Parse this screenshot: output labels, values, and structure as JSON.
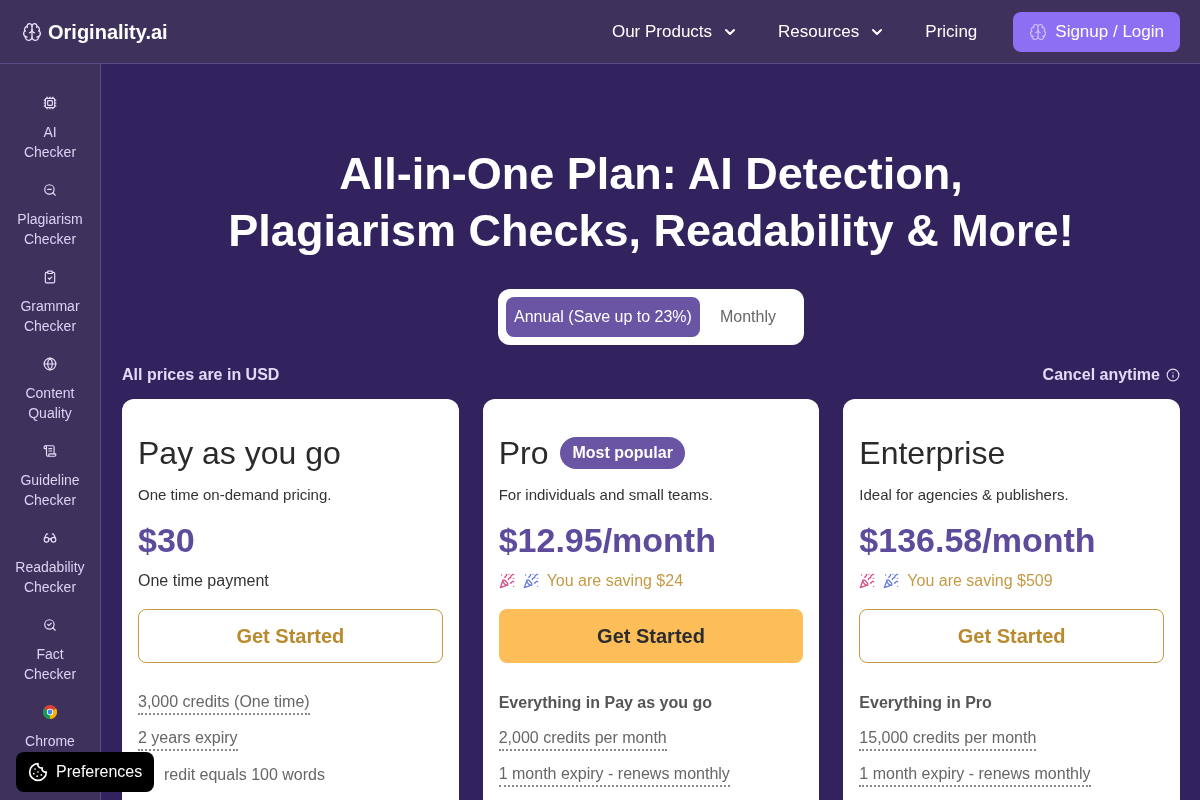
{
  "header": {
    "logo": "Originality.ai",
    "nav": [
      {
        "label": "Our Products",
        "dropdown": true
      },
      {
        "label": "Resources",
        "dropdown": true
      },
      {
        "label": "Pricing",
        "dropdown": false
      }
    ],
    "login_button": "Signup / Login"
  },
  "sidebar": {
    "items": [
      {
        "label": "AI Checker"
      },
      {
        "label": "Plagiarism Checker"
      },
      {
        "label": "Grammar Checker"
      },
      {
        "label": "Content Quality"
      },
      {
        "label": "Guideline Checker"
      },
      {
        "label": "Readability Checker"
      },
      {
        "label": "Fact Checker"
      },
      {
        "label": "Chrome"
      }
    ]
  },
  "headline": [
    "All-in-One Plan: AI Detection,",
    "Plagiarism Checks, Readability & More!"
  ],
  "billing_toggle": [
    {
      "label": "Annual (Save up to 23%)",
      "selected": true
    },
    {
      "label": "Monthly",
      "selected": false
    }
  ],
  "currency_note": "All prices are in USD",
  "cancel_note": "Cancel anytime",
  "plans": [
    {
      "name": "Pay as you go",
      "description": "One time on-demand pricing.",
      "price": "$30",
      "note": {
        "kind": "plain",
        "text": "One time payment"
      },
      "button": {
        "label": "Get Started",
        "highlighted": false
      },
      "features": [
        {
          "kind": "item",
          "text": "3,000 credits (One time)"
        },
        {
          "kind": "item",
          "text": "2 years expiry"
        },
        {
          "kind": "covered",
          "text": "redit equals 100 words"
        }
      ]
    },
    {
      "name": "Pro",
      "badge": "Most popular",
      "description": "For individuals and small teams.",
      "price": "$12.95/month",
      "note": {
        "kind": "saving",
        "text": "You are saving $24"
      },
      "button": {
        "label": "Get Started",
        "highlighted": true
      },
      "features": [
        {
          "kind": "heading",
          "text": "Everything in Pay as you go"
        },
        {
          "kind": "item",
          "text": "2,000 credits per month"
        },
        {
          "kind": "item",
          "text": "1 month expiry - renews monthly"
        }
      ]
    },
    {
      "name": "Enterprise",
      "description": "Ideal for agencies & publishers.",
      "price": "$136.58/month",
      "note": {
        "kind": "saving",
        "text": "You are saving $509"
      },
      "button": {
        "label": "Get Started",
        "highlighted": false
      },
      "features": [
        {
          "kind": "heading",
          "text": "Everything in Pro"
        },
        {
          "kind": "item",
          "text": "15,000 credits per month"
        },
        {
          "kind": "item",
          "text": "1 month expiry - renews monthly"
        }
      ]
    }
  ],
  "preferences_button": "Preferences"
}
